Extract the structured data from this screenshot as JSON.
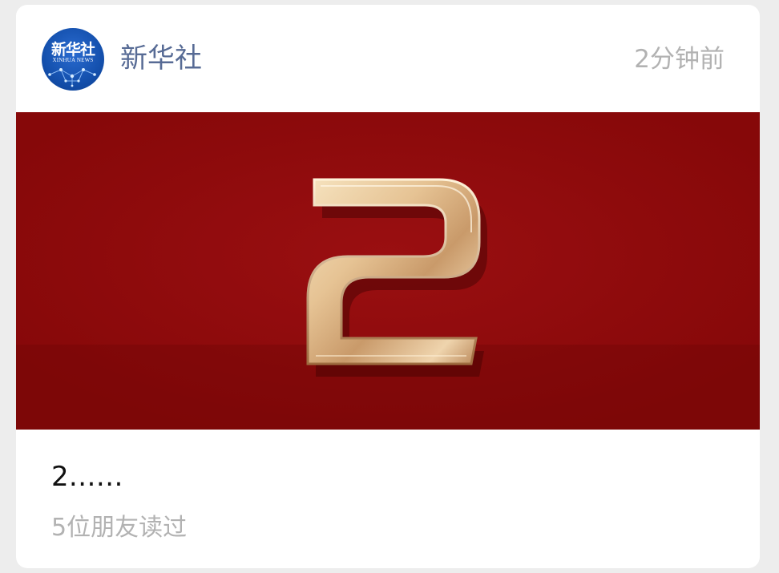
{
  "account": {
    "name": "新华社",
    "logo_text": "新华社",
    "logo_subtext": "XINHUA NEWS"
  },
  "post": {
    "timestamp": "2分钟前",
    "cover_numeral": "2",
    "title": "2……",
    "read_count_label": "5位朋友读过"
  },
  "colors": {
    "account_name": "#576b95",
    "cover_background": "#8f0a0c",
    "numeral_gold": "#e8c9a0",
    "muted_text": "#b2b2b2"
  }
}
